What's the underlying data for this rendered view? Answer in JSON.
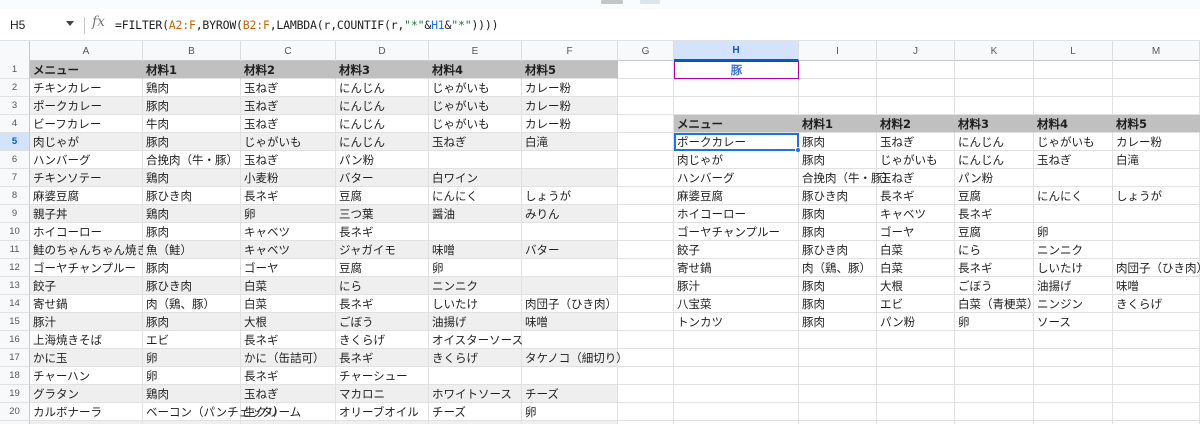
{
  "formula_bar": {
    "name_box": "H5",
    "fx": "fx",
    "formula": [
      {
        "t": "=FILTER(",
        "c": ""
      },
      {
        "t": "A2:F",
        "c": "ref"
      },
      {
        "t": ",BYROW(",
        "c": ""
      },
      {
        "t": "B2:F",
        "c": "ref"
      },
      {
        "t": ",LAMBDA(r,COUNTIF(r,",
        "c": ""
      },
      {
        "t": "\"*\"",
        "c": "str"
      },
      {
        "t": "&",
        "c": ""
      },
      {
        "t": "H1",
        "c": "ref2"
      },
      {
        "t": "&",
        "c": ""
      },
      {
        "t": "\"*\"",
        "c": "str"
      },
      {
        "t": "))))",
        "c": ""
      }
    ]
  },
  "columns": [
    "A",
    "B",
    "C",
    "D",
    "E",
    "F",
    "G",
    "H",
    "I",
    "J",
    "K",
    "L",
    "M"
  ],
  "selected_column": "H",
  "selected_row": "5",
  "h1_value": "豚",
  "source_table": [
    [
      "メニュー",
      "材料1",
      "材料2",
      "材料3",
      "材料4",
      "材料5"
    ],
    [
      "チキンカレー",
      "鶏肉",
      "玉ねぎ",
      "にんじん",
      "じゃがいも",
      "カレー粉"
    ],
    [
      "ポークカレー",
      "豚肉",
      "玉ねぎ",
      "にんじん",
      "じゃがいも",
      "カレー粉"
    ],
    [
      "ビーフカレー",
      "牛肉",
      "玉ねぎ",
      "にんじん",
      "じゃがいも",
      "カレー粉"
    ],
    [
      "肉じゃが",
      "豚肉",
      "じゃがいも",
      "にんじん",
      "玉ねぎ",
      "白滝"
    ],
    [
      "ハンバーグ",
      "合挽肉（牛・豚）",
      "玉ねぎ",
      "パン粉",
      "",
      ""
    ],
    [
      "チキンソテー",
      "鶏肉",
      "小麦粉",
      "バター",
      "白ワイン",
      ""
    ],
    [
      "麻婆豆腐",
      "豚ひき肉",
      "長ネギ",
      "豆腐",
      "にんにく",
      "しょうが"
    ],
    [
      "親子丼",
      "鶏肉",
      "卵",
      "三つ葉",
      "醤油",
      "みりん"
    ],
    [
      "ホイコーロー",
      "豚肉",
      "キャベツ",
      "長ネギ",
      "",
      ""
    ],
    [
      "鮭のちゃんちゃん焼き",
      "魚（鮭）",
      "キャベツ",
      "ジャガイモ",
      "味噌",
      "バター"
    ],
    [
      "ゴーヤチャンプルー",
      "豚肉",
      "ゴーヤ",
      "豆腐",
      "卵",
      ""
    ],
    [
      "餃子",
      "豚ひき肉",
      "白菜",
      "にら",
      "ニンニク",
      ""
    ],
    [
      "寄せ鍋",
      "肉（鶏、豚）",
      "白菜",
      "長ネギ",
      "しいたけ",
      "肉団子（ひき肉）"
    ],
    [
      "豚汁",
      "豚肉",
      "大根",
      "ごぼう",
      "油揚げ",
      "味噌"
    ],
    [
      "上海焼きそば",
      "エビ",
      "長ネギ",
      "きくらげ",
      "オイスターソース",
      ""
    ],
    [
      "かに玉",
      "卵",
      "かに（缶詰可）",
      "長ネギ",
      "きくらげ",
      "タケノコ（細切り）"
    ],
    [
      "チャーハン",
      "卵",
      "長ネギ",
      "チャーシュー",
      "",
      ""
    ],
    [
      "グラタン",
      "鶏肉",
      "玉ねぎ",
      "マカロニ",
      "ホワイトソース",
      "チーズ"
    ],
    [
      "カルボナーラ",
      "ベーコン（パンチェッタ）",
      "生クリーム",
      "オリーブオイル",
      "チーズ",
      "卵"
    ]
  ],
  "result_table": [
    [
      "メニュー",
      "材料1",
      "材料2",
      "材料3",
      "材料4",
      "材料5"
    ],
    [
      "ポークカレー",
      "豚肉",
      "玉ねぎ",
      "にんじん",
      "じゃがいも",
      "カレー粉"
    ],
    [
      "肉じゃが",
      "豚肉",
      "じゃがいも",
      "にんじん",
      "玉ねぎ",
      "白滝"
    ],
    [
      "ハンバーグ",
      "合挽肉（牛・豚）",
      "玉ねぎ",
      "パン粉",
      "",
      ""
    ],
    [
      "麻婆豆腐",
      "豚ひき肉",
      "長ネギ",
      "豆腐",
      "にんにく",
      "しょうが"
    ],
    [
      "ホイコーロー",
      "豚肉",
      "キャベツ",
      "長ネギ",
      "",
      ""
    ],
    [
      "ゴーヤチャンプルー",
      "豚肉",
      "ゴーヤ",
      "豆腐",
      "卵",
      ""
    ],
    [
      "餃子",
      "豚ひき肉",
      "白菜",
      "にら",
      "ニンニク",
      ""
    ],
    [
      "寄せ鍋",
      "肉（鶏、豚）",
      "白菜",
      "長ネギ",
      "しいたけ",
      "肉団子（ひき肉）"
    ],
    [
      "豚汁",
      "豚肉",
      "大根",
      "ごぼう",
      "油揚げ",
      "味噌"
    ],
    [
      "八宝菜",
      "豚肉",
      "エビ",
      "白菜（青梗菜）",
      "ニンジン",
      "きくらげ"
    ],
    [
      "トンカツ",
      "豚肉",
      "パン粉",
      "卵",
      "ソース",
      ""
    ]
  ],
  "colors": {
    "header_gray": "#c0c0c0",
    "band_gray": "#efefef",
    "selection_blue": "#1a73e8",
    "h1_border": "#b100b1",
    "h1_text": "#3c78d8"
  }
}
